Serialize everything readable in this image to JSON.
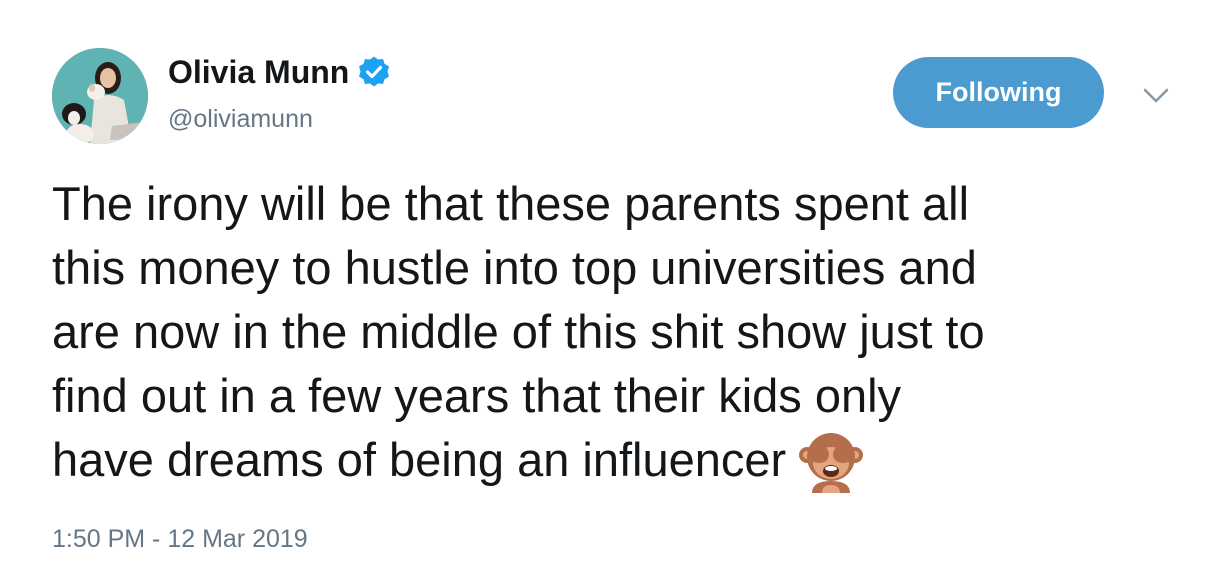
{
  "user": {
    "display_name": "Olivia Munn",
    "handle": "@oliviamunn",
    "verified_icon": "verified-badge-icon",
    "avatar_icon": "profile-photo"
  },
  "follow_button": {
    "label": "Following"
  },
  "menu": {
    "caret_icon": "chevron-down-icon"
  },
  "tweet": {
    "lines": [
      "The irony will be that these parents spent all",
      "this money to hustle into top universities and",
      "are now in the middle of this shit show just to",
      "find out in a few years that their kids only",
      "have dreams of being an influencer"
    ],
    "emoji": "see-no-evil-monkey-icon",
    "timestamp": "1:50 PM - 12 Mar 2019"
  },
  "colors": {
    "button_bg": "#4b9bd0",
    "verified": "#1da1f2",
    "secondary_text": "#657786",
    "primary_text": "#14171a"
  }
}
